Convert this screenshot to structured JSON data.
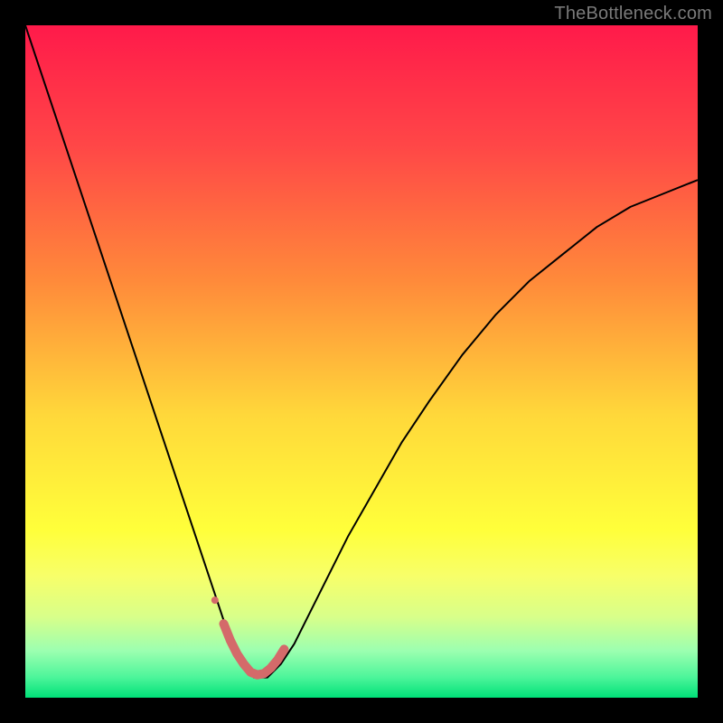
{
  "watermark": "TheBottleneck.com",
  "chart_data": {
    "type": "line",
    "title": "",
    "xlabel": "",
    "ylabel": "",
    "xlim": [
      0,
      100
    ],
    "ylim": [
      0,
      100
    ],
    "legend": "none",
    "grid": false,
    "background": {
      "type": "vertical-gradient",
      "stops": [
        {
          "pos": 0.0,
          "color": "#ff1a4a"
        },
        {
          "pos": 0.18,
          "color": "#ff4747"
        },
        {
          "pos": 0.38,
          "color": "#ff8a3a"
        },
        {
          "pos": 0.58,
          "color": "#ffd83a"
        },
        {
          "pos": 0.75,
          "color": "#ffff3a"
        },
        {
          "pos": 0.82,
          "color": "#f7ff6a"
        },
        {
          "pos": 0.88,
          "color": "#d8ff8a"
        },
        {
          "pos": 0.93,
          "color": "#9cffb0"
        },
        {
          "pos": 0.97,
          "color": "#4cf59a"
        },
        {
          "pos": 1.0,
          "color": "#00e078"
        }
      ]
    },
    "series": [
      {
        "name": "bottleneck-curve",
        "stroke": "#000000",
        "stroke_width": 2,
        "x": [
          0,
          2,
          4,
          6,
          8,
          10,
          12,
          14,
          16,
          18,
          20,
          22,
          24,
          26,
          28,
          30,
          31,
          32,
          33,
          34,
          35,
          36,
          37,
          38,
          40,
          42,
          45,
          48,
          52,
          56,
          60,
          65,
          70,
          75,
          80,
          85,
          90,
          95,
          100
        ],
        "y": [
          100,
          94,
          88,
          82,
          76,
          70,
          64,
          58,
          52,
          46,
          40,
          34,
          28,
          22,
          16,
          10,
          8,
          6,
          4,
          3,
          3,
          3,
          4,
          5,
          8,
          12,
          18,
          24,
          31,
          38,
          44,
          51,
          57,
          62,
          66,
          70,
          73,
          75,
          77
        ]
      },
      {
        "name": "highlight-arc",
        "stroke": "#d46a6a",
        "stroke_width": 10,
        "linecap": "round",
        "x": [
          29.5,
          30.5,
          31.5,
          32.5,
          33.5,
          34.5,
          35.5,
          36.5,
          37.5,
          38.5
        ],
        "y": [
          11,
          8.5,
          6.5,
          5,
          3.8,
          3.4,
          3.6,
          4.4,
          5.6,
          7.2
        ]
      },
      {
        "name": "highlight-dot",
        "type": "scatter",
        "fill": "#d46a6a",
        "radius": 4,
        "x": [
          28.2
        ],
        "y": [
          14.5
        ]
      }
    ]
  }
}
